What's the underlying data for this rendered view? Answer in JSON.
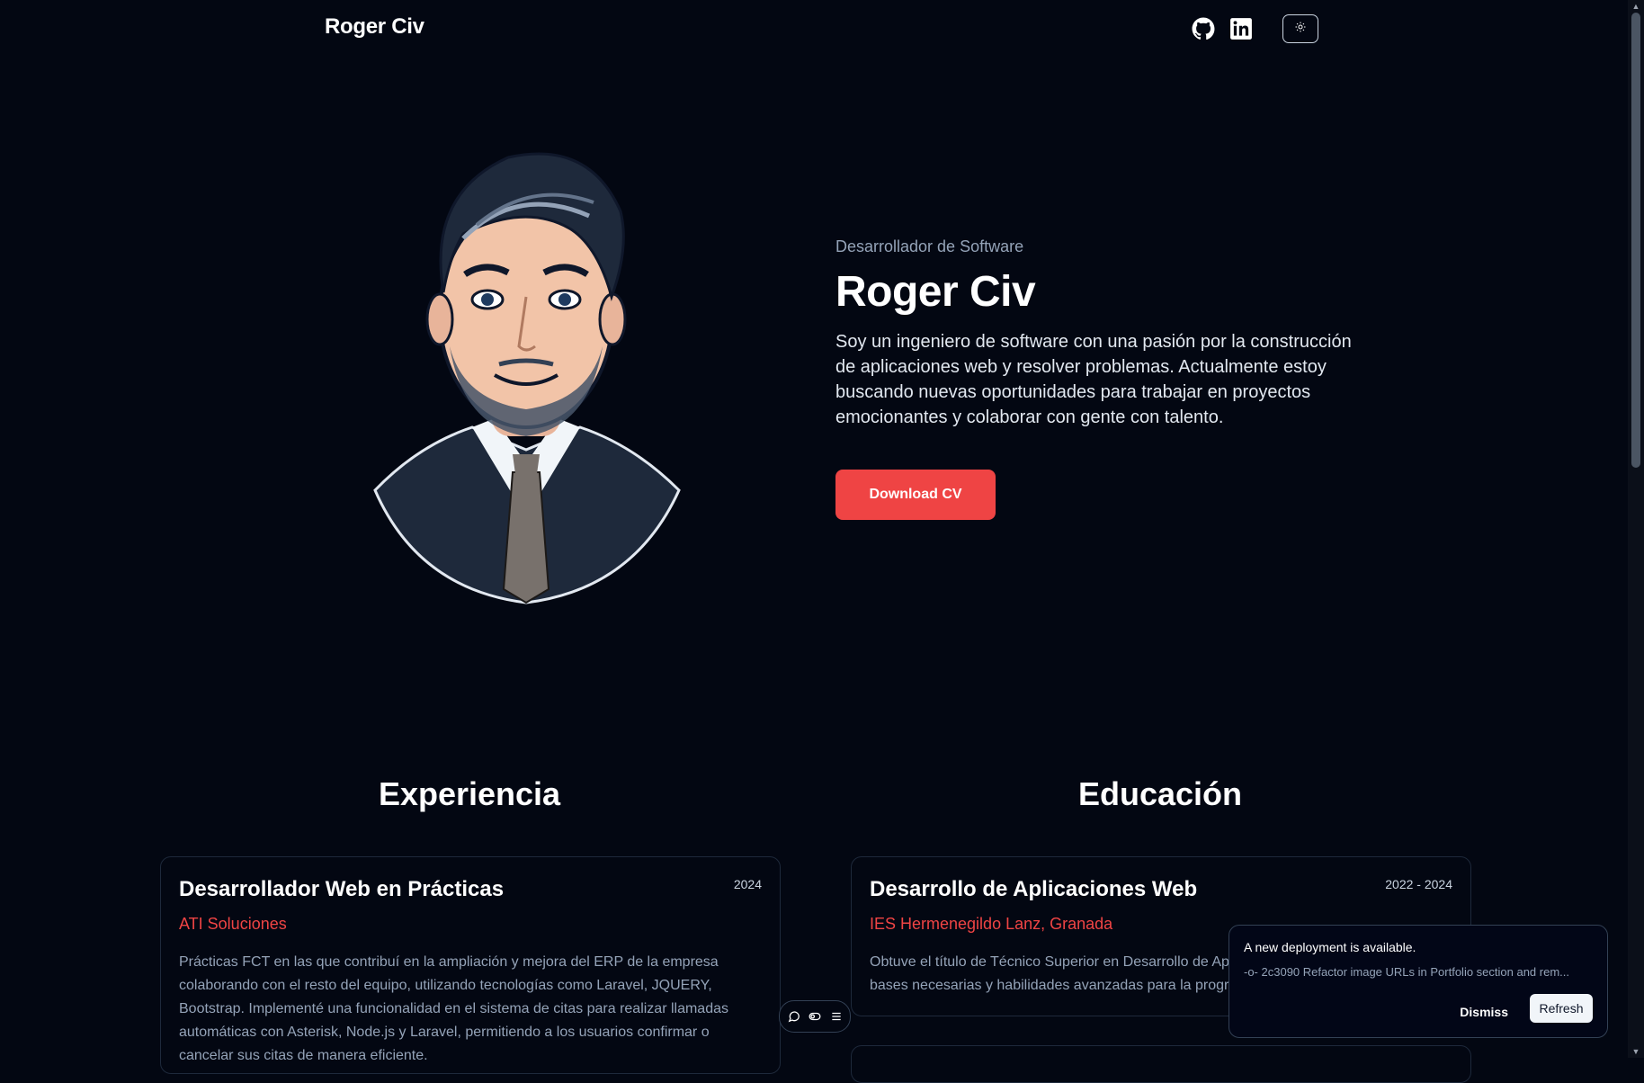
{
  "header": {
    "brand": "Roger Civ",
    "icons": [
      "github-icon",
      "linkedin-icon",
      "sun-icon"
    ]
  },
  "hero": {
    "subtitle": "Desarrollador de Software",
    "name": "Roger Civ",
    "description": "Soy un ingeniero de software con una pasión por la construcción de aplicaciones web y resolver problemas. Actualmente estoy buscando nuevas oportunidades para trabajar en proyectos emocionantes y colaborar con gente con talento.",
    "cta_label": "Download CV"
  },
  "experience": {
    "title": "Experiencia",
    "items": [
      {
        "role": "Desarrollador Web en Prácticas",
        "date": "2024",
        "company": "ATI Soluciones",
        "description": "Prácticas FCT en las que contribuí en la ampliación y mejora del ERP de la empresa colaborando con el resto del equipo, utilizando tecnologías como Laravel, JQUERY, Bootstrap. Implementé una funcionalidad en el sistema de citas para realizar llamadas automáticas con Asterisk, Node.js y Laravel, permitiendo a los usuarios confirmar o cancelar sus citas de manera eficiente."
      }
    ]
  },
  "education": {
    "title": "Educación",
    "items": [
      {
        "degree": "Desarrollo de Aplicaciones Web",
        "date": "2022 - 2024",
        "school": "IES Hermenegildo Lanz, Granada",
        "description": "Obtuve el título de Técnico Superior en Desarrollo de Aplicaciones Web, adquiriendo las bases necesarias y habilidades avanzadas para la programación"
      }
    ]
  },
  "toolbar_icons": [
    "comment-icon",
    "toggle-icon",
    "menu-icon"
  ],
  "toast": {
    "title": "A new deployment is available.",
    "commit": "-o- 2c3090 Refactor image URLs in Portfolio section and rem...",
    "dismiss_label": "Dismiss",
    "refresh_label": "Refresh"
  },
  "colors": {
    "background": "#030712",
    "accent": "#ef4444",
    "muted_text": "#94a3b8"
  }
}
